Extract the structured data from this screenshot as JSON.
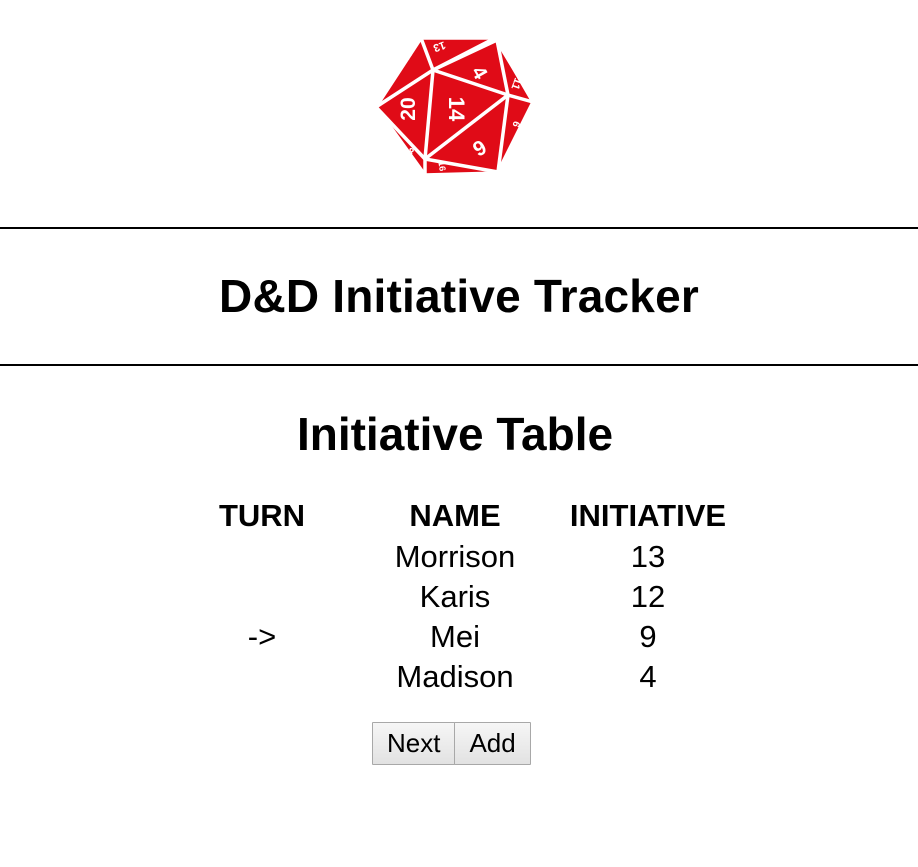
{
  "logo": {
    "icon": "d20-icon",
    "color": "#e00b17",
    "faces": [
      "20",
      "14",
      "4",
      "6",
      "13",
      "11",
      "2",
      "9",
      "8",
      "16"
    ]
  },
  "header": {
    "title": "D&D Initiative Tracker"
  },
  "initiative": {
    "title": "Initiative Table",
    "columns": {
      "turn": "TURN",
      "name": "NAME",
      "initiative": "INITIATIVE"
    },
    "rows": [
      {
        "turn": "",
        "name": "Morrison",
        "initiative": "13"
      },
      {
        "turn": "",
        "name": "Karis",
        "initiative": "12"
      },
      {
        "turn": "->",
        "name": "Mei",
        "initiative": "9"
      },
      {
        "turn": "",
        "name": "Madison",
        "initiative": "4"
      }
    ]
  },
  "controls": {
    "next_label": "Next",
    "add_label": "Add"
  }
}
